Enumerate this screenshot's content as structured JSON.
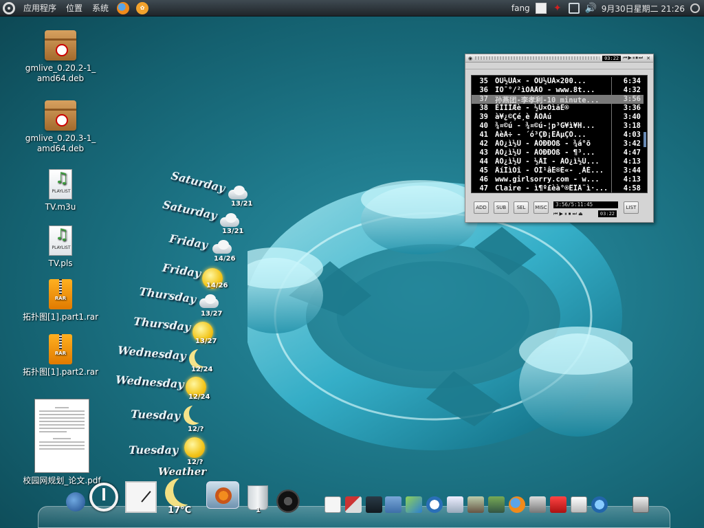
{
  "top_panel": {
    "menu": [
      "应用程序",
      "位置",
      "系统"
    ],
    "user": "fang",
    "datetime": "9月30日星期二 21:26"
  },
  "desktop_icons": [
    {
      "label_line1": "gmlive_0.20.2-1_",
      "label_line2": "amd64.deb",
      "icon": "package-icon"
    },
    {
      "label_line1": "gmlive_0.20.3-1_",
      "label_line2": "amd64.deb",
      "icon": "package-icon"
    },
    {
      "label_line1": "TV.m3u",
      "label_line2": "",
      "icon": "playlist-icon",
      "badge": "PLAYLIST"
    },
    {
      "label_line1": "TV.pls",
      "label_line2": "",
      "icon": "playlist-icon",
      "badge": "PLAYLIST"
    },
    {
      "label_line1": "拓扑图[1].part1.rar",
      "label_line2": "",
      "icon": "rar-icon",
      "badge": "RAR"
    },
    {
      "label_line1": "拓扑图[1].part2.rar",
      "label_line2": "",
      "icon": "rar-icon",
      "badge": "RAR"
    },
    {
      "label_line1": "校园网规划_论文.pdf",
      "label_line2": "",
      "icon": "pdf-icon"
    }
  ],
  "weather": {
    "title": "Weather",
    "days": [
      {
        "day": "Saturday",
        "temp": "13/21",
        "icon": "cloud-rain"
      },
      {
        "day": "Saturday",
        "temp": "13/21",
        "icon": "cloud-rain"
      },
      {
        "day": "Friday",
        "temp": "14/26",
        "icon": "cloud"
      },
      {
        "day": "Friday",
        "temp": "14/26",
        "icon": "sun-cloud"
      },
      {
        "day": "Thursday",
        "temp": "13/27",
        "icon": "cloud-rain"
      },
      {
        "day": "Thursday",
        "temp": "13/27",
        "icon": "sun"
      },
      {
        "day": "Wednesday",
        "temp": "12/24",
        "icon": "moon-cloud"
      },
      {
        "day": "Wednesday",
        "temp": "12/24",
        "icon": "sun"
      },
      {
        "day": "Tuesday",
        "temp": "12/?",
        "icon": "moon"
      },
      {
        "day": "Tuesday",
        "temp": "12/?",
        "icon": "sun-cloud"
      }
    ]
  },
  "player": {
    "mini_time": "03:22",
    "playlist": [
      {
        "num": "35",
        "title": "ÖÙ½ÜÀ× - ÖÙ½ÜÀ×200...",
        "dur": "6:34"
      },
      {
        "num": "36",
        "title": "ÌÖ¯°/²ìÒÀÂÖ - www.8t...",
        "dur": "4:32"
      },
      {
        "num": "37",
        "title": "孙燕团-李孝利-10 minute...",
        "dur": "3:56",
        "selected": true
      },
      {
        "num": "38",
        "title": "ÈÌÌÌÆè - ½Ú×ÒìãË®",
        "dur": "3:36"
      },
      {
        "num": "39",
        "title": "à¥¿©Çé¸è ÅÔÁú",
        "dur": "3:40"
      },
      {
        "num": "40",
        "title": "¾¤©ú - ¾¤©ú-¦p³G¥ì¥H...",
        "dur": "3:18"
      },
      {
        "num": "41",
        "title": "ÀèÃ÷ - ´ó³ÇÐ¡ÊÂµÇÔ...",
        "dur": "4:03"
      },
      {
        "num": "42",
        "title": "ÁÖ¿ì½Ü - ÀÖÐÐÕß - ¾á°õ",
        "dur": "3:42"
      },
      {
        "num": "43",
        "title": "ÁÖ¿ì½Ü - ÀÖÐÐÕß - ¶³...",
        "dur": "4:47"
      },
      {
        "num": "44",
        "title": "ÁÖ¿ì½Ü - ½ÃÌ - ÁÖ¿ì½Ü...",
        "dur": "4:13"
      },
      {
        "num": "45",
        "title": "ÂíÌìÓî - ÓÌ¹âÊ®É«- ¸ÃÈ...",
        "dur": "3:44"
      },
      {
        "num": "46",
        "title": "www.girlsorry.com - w...",
        "dur": "4:13"
      },
      {
        "num": "47",
        "title": "Claire - ì¶º£èà°®ÊÎÃ¨ì·...",
        "dur": "4:58"
      }
    ],
    "buttons": {
      "add": "ADD",
      "sub": "SUB",
      "sel": "SEL",
      "misc": "MISC",
      "list": "LIST"
    },
    "total_time": "3:56/5:11:45",
    "current_time": "03:22"
  },
  "dock": {
    "temperature": "17°C",
    "trash_count": "1"
  }
}
